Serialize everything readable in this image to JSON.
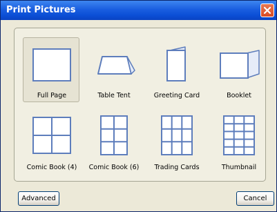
{
  "window": {
    "title": "Print Pictures"
  },
  "layouts": [
    {
      "label": "Full Page",
      "icon": "full-page-icon",
      "selected": true
    },
    {
      "label": "Table Tent",
      "icon": "table-tent-icon",
      "selected": false
    },
    {
      "label": "Greeting Card",
      "icon": "greeting-card-icon",
      "selected": false
    },
    {
      "label": "Booklet",
      "icon": "booklet-icon",
      "selected": false
    },
    {
      "label": "Comic Book (4)",
      "icon": "comic-book-4-icon",
      "selected": false
    },
    {
      "label": "Comic Book (6)",
      "icon": "comic-book-6-icon",
      "selected": false
    },
    {
      "label": "Trading Cards",
      "icon": "trading-cards-icon",
      "selected": false
    },
    {
      "label": "Thumbnail",
      "icon": "thumbnail-icon",
      "selected": false
    }
  ],
  "buttons": {
    "advanced": "Advanced",
    "cancel": "Cancel"
  },
  "colors": {
    "titlebar": "#0b4fd6",
    "close": "#d84a22",
    "icon_stroke": "#5d7dbc",
    "icon_fill": "#ffffff",
    "dialog_bg": "#ece9d8"
  }
}
